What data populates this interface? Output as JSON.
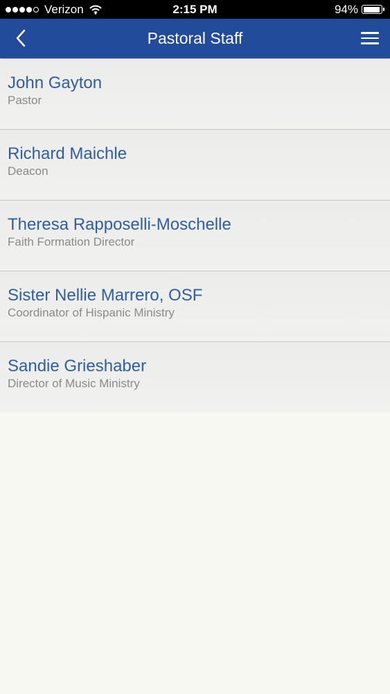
{
  "status_bar": {
    "carrier": "Verizon",
    "signal_bars_filled": 4,
    "signal_bars_total": 5,
    "time": "2:15 PM",
    "battery_percent": "94%",
    "battery_level": 0.94,
    "icons": [
      "signal-icon",
      "wifi-icon",
      "battery-icon"
    ]
  },
  "nav": {
    "title": "Pastoral Staff",
    "back_icon": "chevron-left-icon",
    "menu_icon": "hamburger-menu-icon",
    "background_color": "#224c9b"
  },
  "staff": [
    {
      "name": "John Gayton",
      "role": "Pastor"
    },
    {
      "name": "Richard Maichle",
      "role": "Deacon"
    },
    {
      "name": "Theresa Rapposelli-Moschelle",
      "role": "Faith Formation Director"
    },
    {
      "name": "Sister Nellie Marrero, OSF",
      "role": "Coordinator of Hispanic Ministry"
    },
    {
      "name": "Sandie Grieshaber",
      "role": "Director of Music Ministry"
    }
  ],
  "colors": {
    "name_text": "#2f5ea8",
    "role_text": "#8a8a8a",
    "list_background": "#ececec",
    "page_background": "#f8f8f3"
  }
}
